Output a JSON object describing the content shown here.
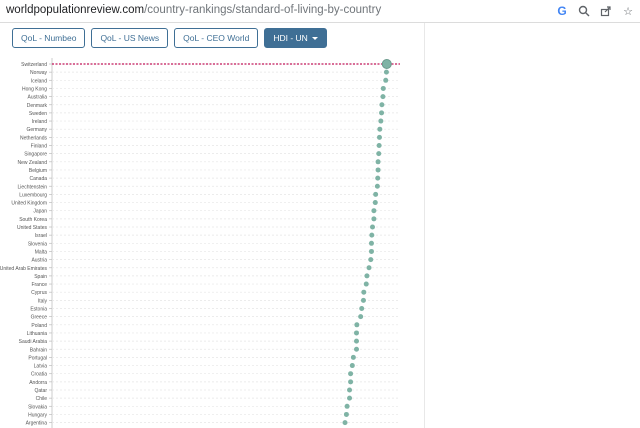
{
  "browser": {
    "url_domain": "worldpopulationreview.com",
    "url_path": "/country-rankings/standard-of-living-by-country",
    "icons": [
      "google-icon",
      "zoom-icon",
      "share-icon",
      "bookmark-star-icon"
    ]
  },
  "tabs": [
    {
      "label": "QoL - Numbeo",
      "active": false
    },
    {
      "label": "QoL - US News",
      "active": false
    },
    {
      "label": "QoL - CEO World",
      "active": false
    },
    {
      "label": "HDI - UN",
      "active": true
    }
  ],
  "colors": {
    "accent": "#3f6f95",
    "dot": "#7fb3a5",
    "reference_line": "#c2185b"
  },
  "chart_data": {
    "type": "scatter",
    "orientation": "horizontal",
    "categories": [
      "Switzerland",
      "Norway",
      "Iceland",
      "Hong Kong",
      "Australia",
      "Denmark",
      "Sweden",
      "Ireland",
      "Germany",
      "Netherlands",
      "Finland",
      "Singapore",
      "New Zealand",
      "Belgium",
      "Canada",
      "Liechtenstein",
      "Luxembourg",
      "United Kingdom",
      "Japan",
      "South Korea",
      "United States",
      "Israel",
      "Slovenia",
      "Malta",
      "Austria",
      "United Arab Emirates",
      "Spain",
      "France",
      "Cyprus",
      "Italy",
      "Estonia",
      "Greece",
      "Poland",
      "Lithuania",
      "Saudi Arabia",
      "Bahrain",
      "Portugal",
      "Latvia",
      "Croatia",
      "Andorra",
      "Qatar",
      "Chile",
      "Slovakia",
      "Hungary",
      "Argentina"
    ],
    "values": [
      0.962,
      0.961,
      0.959,
      0.952,
      0.951,
      0.948,
      0.947,
      0.945,
      0.942,
      0.941,
      0.94,
      0.939,
      0.937,
      0.937,
      0.936,
      0.935,
      0.93,
      0.929,
      0.925,
      0.925,
      0.921,
      0.919,
      0.918,
      0.918,
      0.916,
      0.911,
      0.905,
      0.903,
      0.896,
      0.895,
      0.89,
      0.887,
      0.876,
      0.875,
      0.875,
      0.875,
      0.866,
      0.863,
      0.858,
      0.858,
      0.855,
      0.855,
      0.848,
      0.846,
      0.842
    ],
    "xlim": [
      0,
      1
    ],
    "highlight_index": 0,
    "reference_value": 0.962
  }
}
